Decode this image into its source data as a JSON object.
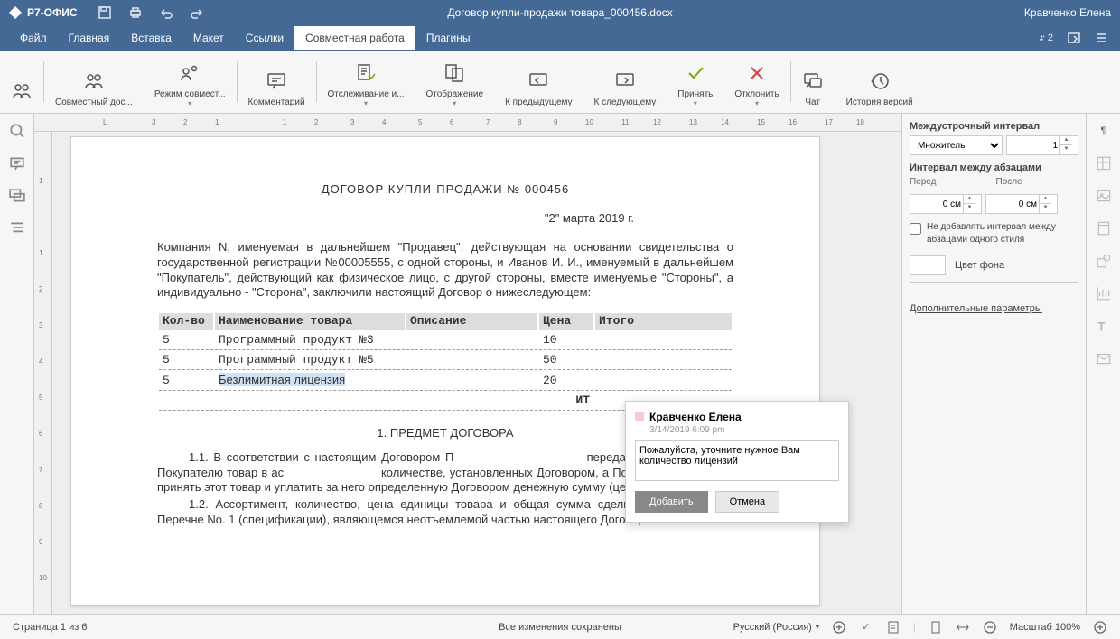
{
  "app_name": "Р7-ОФИС",
  "document_title": "Договор купли-продажи товара_000456.docx",
  "user_name": "Кравченко Елена",
  "menu": [
    "Файл",
    "Главная",
    "Вставка",
    "Макет",
    "Ссылки",
    "Совместная работа",
    "Плагины"
  ],
  "active_menu": "Совместная работа",
  "user_count": "2",
  "toolbar": {
    "share": "Совместный дос...",
    "coedit": "Режим совмест...",
    "comment": "Комментарий",
    "track": "Отслеживание и...",
    "display": "Отображение",
    "prev": "К предыдущему",
    "next": "К следующему",
    "accept": "Принять",
    "reject": "Отклонить",
    "chat": "Чат",
    "history": "История версий"
  },
  "document": {
    "title": "ДОГОВОР КУПЛИ-ПРОДАЖИ № 000456",
    "date": "\"2\" марта 2019 г.",
    "intro": "Компания N, именуемая в дальнейшем \"Продавец\", действующая на основании свидетельства о государственной регистрации №00005555, с одной стороны, и Иванов И. И., именуемый в дальнейшем \"Покупатель\", действующий как физическое лицо, с другой стороны, вместе именуемые \"Стороны\", а индивидуально - \"Сторона\", заключили настоящий Договор о нижеследующем:",
    "table_headers": [
      "Кол-во",
      "Наименование товара",
      "Описание",
      "Цена",
      "Итого"
    ],
    "table_rows": [
      {
        "qty": "5",
        "name": "Программный продукт №3",
        "desc": "",
        "price": "10",
        "total": ""
      },
      {
        "qty": "5",
        "name": "Программный продукт №5",
        "desc": "",
        "price": "50",
        "total": ""
      },
      {
        "qty": "5",
        "name": "Безлимитная лицензия",
        "desc": "",
        "price": "20",
        "total": ""
      }
    ],
    "table_footer": "ИТ",
    "section1": "1. ПРЕДМЕТ ДОГОВОРА",
    "p1_1": "1.1. В соответствии с настоящим Договором П                          передать в собственность Покупателю товар в ас                          количестве, установленных Договором, а Покупатель обязуется принять этот товар и уплатить за него определенную Договором денежную сумму (цену).",
    "p1_2": "1.2. Ассортимент, количество, цена единицы товара и общая сумма сделки определяются в Перечне No. 1 (спецификации), являющемся неотъемлемой частью настоящего Договора."
  },
  "comment": {
    "author": "Кравченко Елена",
    "datetime": "3/14/2019 6:09 pm",
    "text": "Пожалуйста, уточните нужное Вам количество лицензий",
    "add_btn": "Добавить",
    "cancel_btn": "Отмена"
  },
  "right_panel": {
    "line_spacing_label": "Междустрочный интервал",
    "line_spacing_type": "Множитель",
    "line_spacing_value": "1",
    "para_spacing_label": "Интервал между абзацами",
    "before_label": "Перед",
    "after_label": "После",
    "before_value": "0 см",
    "after_value": "0 см",
    "no_space_check": "Не добавлять интервал между абзацами одного стиля",
    "fill_label": "Цвет фона",
    "advanced_link": "Дополнительные параметры"
  },
  "statusbar": {
    "page": "Страница 1 из 6",
    "changes_saved": "Все изменения сохранены",
    "language": "Русский (Россия)",
    "zoom": "Масштаб 100%"
  }
}
